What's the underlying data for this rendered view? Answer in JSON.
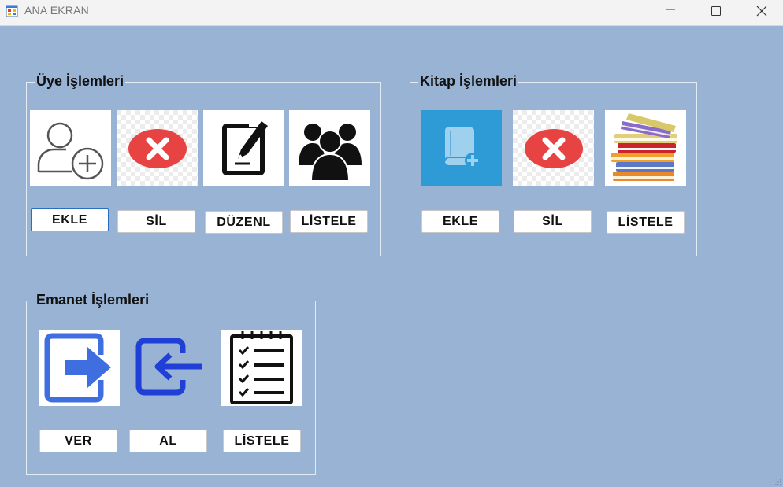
{
  "window": {
    "title": "ANA EKRAN",
    "icons": {
      "app": "app-form-icon",
      "minimize": "minimize-icon",
      "maximize": "maximize-icon",
      "close": "close-icon"
    }
  },
  "uye": {
    "title": "Üye İşlemleri",
    "icons": [
      "add-user-icon",
      "delete-icon",
      "edit-icon",
      "users-group-icon"
    ],
    "buttons": [
      "EKLE",
      "SİL",
      "DÜZENL",
      "LİSTELE"
    ]
  },
  "kitap": {
    "title": "Kitap İşlemleri",
    "icons": [
      "add-book-icon",
      "delete-icon",
      "books-stack-icon"
    ],
    "buttons": [
      "EKLE",
      "SİL",
      "LİSTELE"
    ]
  },
  "emanet": {
    "title": "Emanet İşlemleri",
    "icons": [
      "give-out-icon",
      "take-back-icon",
      "checklist-icon"
    ],
    "buttons": [
      "VER",
      "AL",
      "LİSTELE"
    ]
  },
  "colors": {
    "background": "#98b3d3",
    "group_border": "#e3ebf4",
    "delete_red": "#e84343",
    "book_tile": "#2f9bd6",
    "arrow_blue": "#3f6ee0"
  }
}
